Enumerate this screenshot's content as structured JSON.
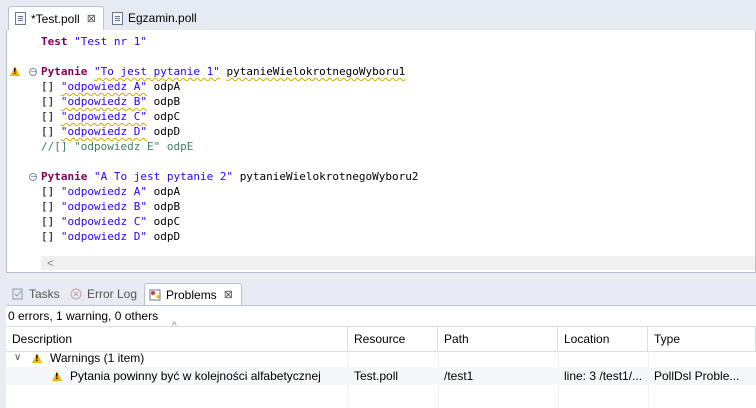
{
  "editor_tabs": [
    {
      "label": "*Test.poll",
      "close": "⊠",
      "active": true
    },
    {
      "label": "Egzamin.poll",
      "active": false
    }
  ],
  "code": {
    "line1": {
      "kw": "Test",
      "str": "\"Test nr 1\""
    },
    "q1": {
      "kw": "Pytanie",
      "str": "\"To jest pytanie 1\"",
      "id": "pytanieWielokrotnegoWyboru1"
    },
    "q1_answers": [
      {
        "box": "[]",
        "str": "\"odpowiedz A\"",
        "id": "odpA"
      },
      {
        "box": "[]",
        "str": "\"odpowiedz B\"",
        "id": "odpB"
      },
      {
        "box": "[]",
        "str": "\"odpowiedz C\"",
        "id": "odpC"
      },
      {
        "box": "[]",
        "str": "\"odpowiedz D\"",
        "id": "odpD"
      }
    ],
    "comment": "//[] \"odpowiedz E\" odpE",
    "q2": {
      "kw": "Pytanie",
      "str": "\"A To jest pytanie 2\"",
      "id": "pytanieWielokrotnegoWyboru2"
    },
    "q2_answers": [
      {
        "box": "[]",
        "str": "\"odpowiedz A\"",
        "id": "odpA"
      },
      {
        "box": "[]",
        "str": "\"odpowiedz B\"",
        "id": "odpB"
      },
      {
        "box": "[]",
        "str": "\"odpowiedz C\"",
        "id": "odpC"
      },
      {
        "box": "[]",
        "str": "\"odpowiedz D\"",
        "id": "odpD"
      }
    ],
    "scroll_left": "<"
  },
  "views": {
    "tabs": [
      {
        "label": "Tasks"
      },
      {
        "label": "Error Log"
      },
      {
        "label": "Problems",
        "close": "⊠"
      }
    ]
  },
  "problems": {
    "summary": "0 errors, 1 warning, 0 others",
    "columns": [
      "Description",
      "Resource",
      "Path",
      "Location",
      "Type"
    ],
    "group": "Warnings (1 item)",
    "item": {
      "description": "Pytania powinny być w kolejności alfabetycznej",
      "resource": "Test.poll",
      "path": "/test1",
      "location": "line: 3 /test1/...",
      "type": "PollDsl Proble..."
    }
  },
  "colors": {
    "keyword": "#7f0055",
    "string": "#2a00ff",
    "comment": "#3f7f5f",
    "warning": "#f2b705"
  }
}
